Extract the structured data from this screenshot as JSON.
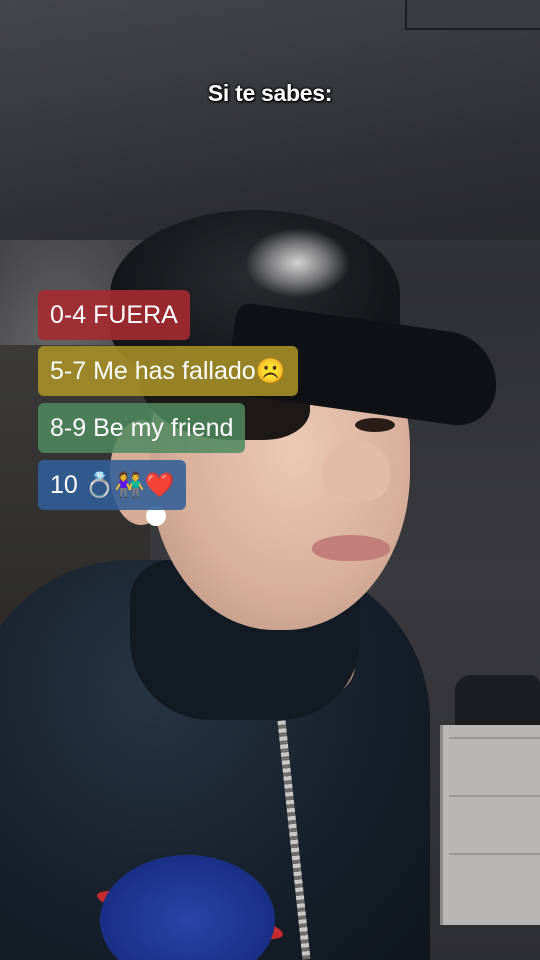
{
  "caption": "Si te sabes:",
  "labels": {
    "red": {
      "text": "0-4 FUERA"
    },
    "yellow": {
      "text": "5-7 Me has fallado",
      "emoji": "☹️"
    },
    "green": {
      "text": "8-9 Be my friend"
    },
    "blue": {
      "text": "10",
      "emoji": "💍👫❤️"
    }
  },
  "colors": {
    "red_label": "#a52a30",
    "yellow_label": "#a89228",
    "green_label": "#4d8a5f",
    "blue_label": "#315f98"
  }
}
